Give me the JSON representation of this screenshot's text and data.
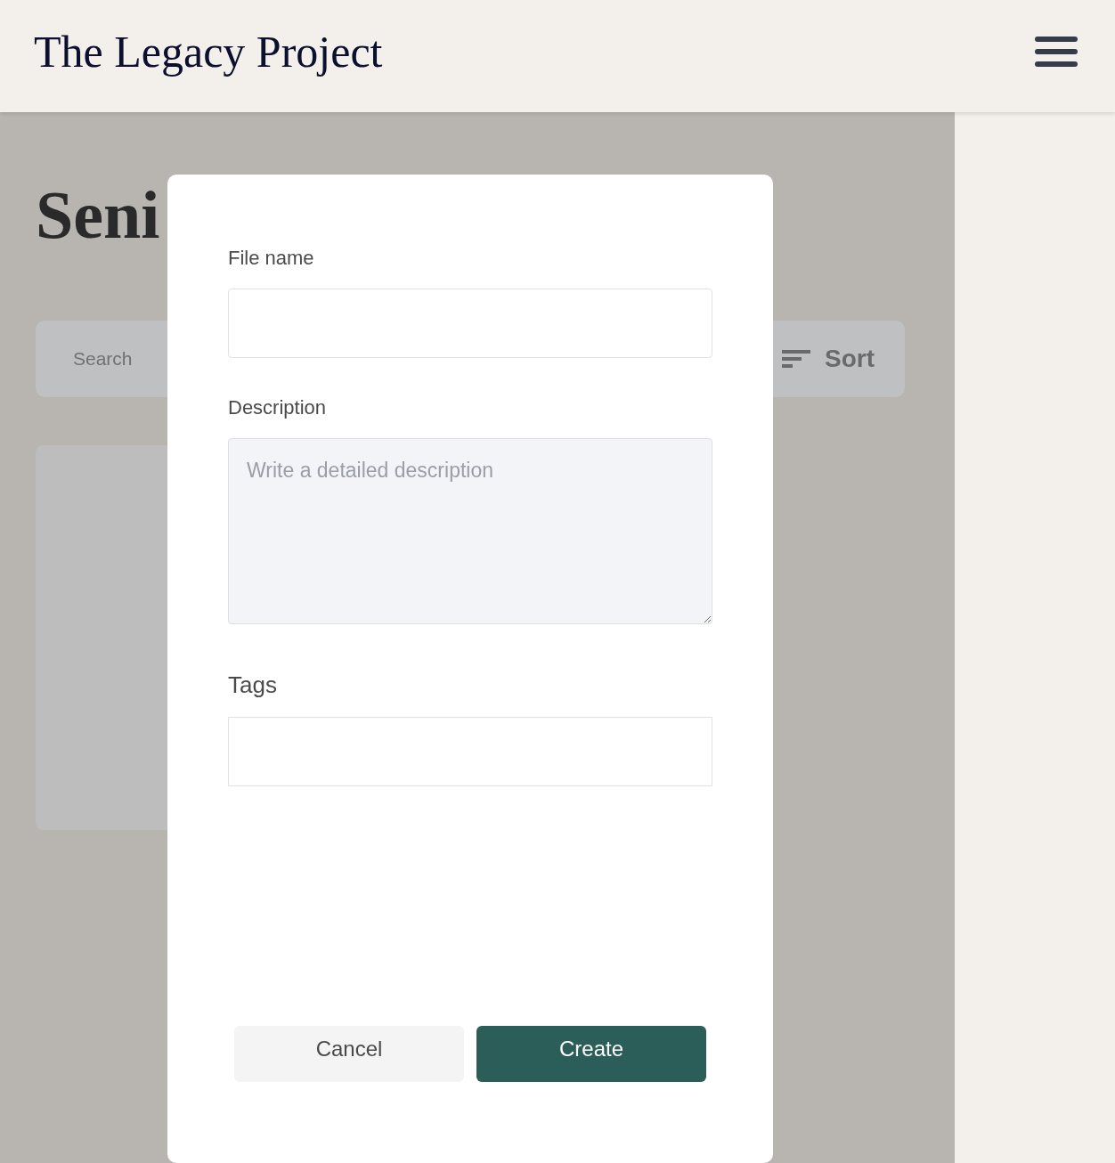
{
  "header": {
    "title": "The Legacy Project"
  },
  "page": {
    "heading": "Seni",
    "search": {
      "placeholder": "Search"
    },
    "sort_button": "Sort"
  },
  "dialog": {
    "fields": [
      {
        "kind": "input",
        "label": "File name"
      },
      {
        "kind": "textarea",
        "label": "Description",
        "placeholder": "Write a detailed description"
      },
      {
        "kind": "tags",
        "label": "Tags"
      }
    ],
    "buttons": [
      {
        "label": "Cancel",
        "kind": "secondary"
      },
      {
        "label": "Create",
        "kind": "primary"
      }
    ]
  }
}
